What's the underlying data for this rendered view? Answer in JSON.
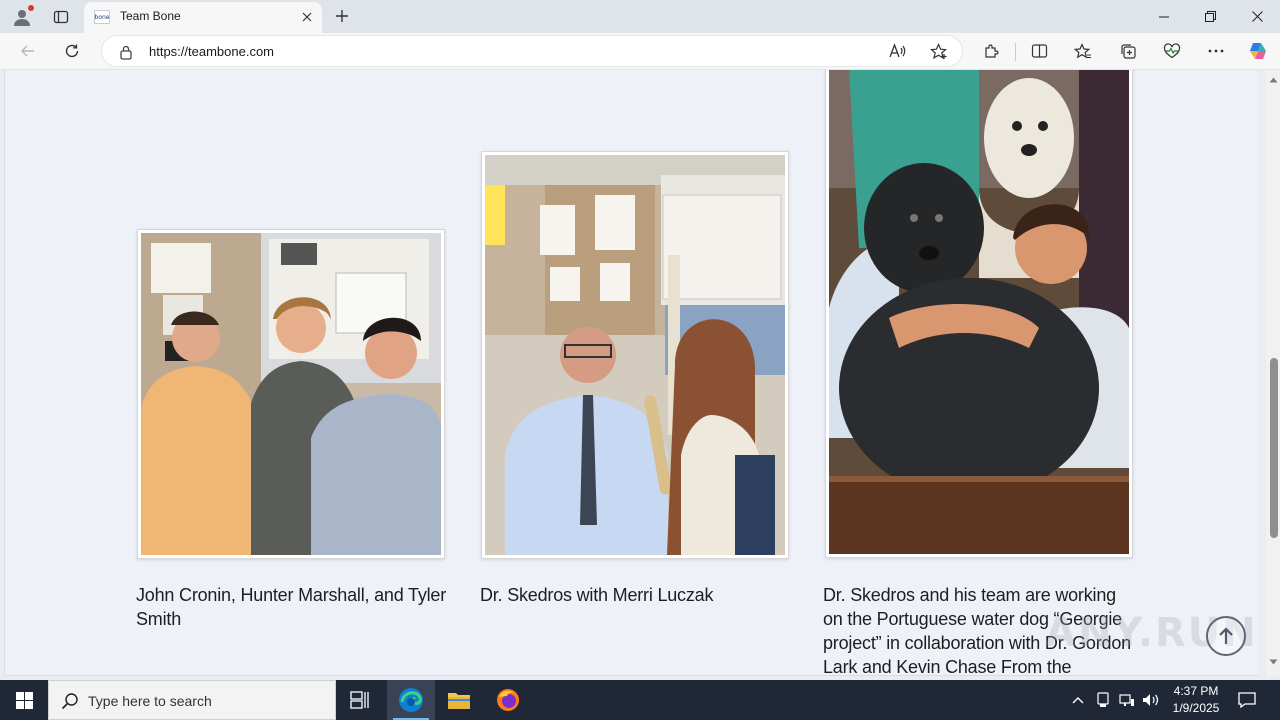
{
  "browser": {
    "tab_title": "Team Bone",
    "favicon_text": "bone",
    "url": "https://teambone.com"
  },
  "icons": {
    "profile": "profile-icon",
    "tab_actions": "tab-actions-icon",
    "close_tab": "close-icon",
    "new_tab": "plus-icon",
    "minimize": "minimize-icon",
    "restore": "restore-icon",
    "close_window": "close-icon",
    "back": "back-arrow-icon",
    "refresh": "refresh-icon",
    "lock": "lock-icon",
    "read_aloud": "read-aloud-icon",
    "favorite": "star-icon",
    "extensions": "puzzle-icon",
    "split_screen": "split-screen-icon",
    "favorites": "favorites-icon",
    "collections": "collections-icon",
    "performance": "heart-pulse-icon",
    "more": "more-icon",
    "copilot": "copilot-icon",
    "scroll_top": "arrow-up-icon"
  },
  "page": {
    "cards": [
      {
        "caption": "John Cronin, Hunter Marshall, and Tyler Smith",
        "image_alt": "Three young men standing in a lab office with posters"
      },
      {
        "caption": "Dr. Skedros with Merri Luczak",
        "image_alt": "Dr. Skedros seated beside a student holding a bone"
      },
      {
        "caption": "Dr. Skedros and his team are working on the Portuguese water dog “Georgie project” in collaboration with Dr. Gordon Lark and Kevin Chase From the",
        "image_alt": "Girl hugging a black Portuguese water dog with a white dog behind"
      }
    ],
    "watermark": "ANY.RUN"
  },
  "colors": {
    "page_bg": "#eef1f8",
    "taskbar": "#202838",
    "edge_accent": "#0f7fd6"
  },
  "taskbar": {
    "search_placeholder": "Type here to search",
    "time": "4:37 PM",
    "date": "1/9/2025"
  }
}
